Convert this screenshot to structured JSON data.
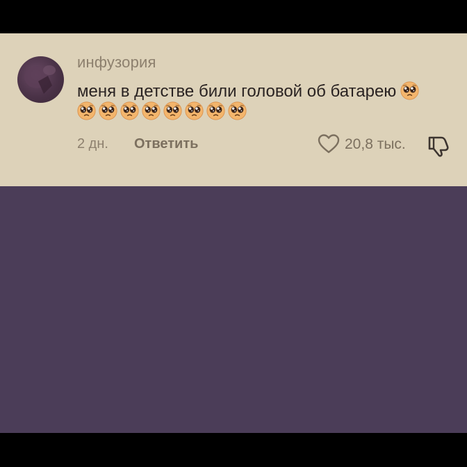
{
  "comment": {
    "username": "инфузория",
    "text": "меня в детстве били головой об батарею",
    "emoji_icon": "pleading-face-emoji",
    "emoji_count_inline": 1,
    "emoji_count_row": 8,
    "time_ago": "2 дн.",
    "reply_label": "Ответить",
    "like_count": "20,8 тыс."
  },
  "colors": {
    "card_background": "#ddd2b9",
    "video_area": "#4b3d58",
    "letterbox": "#000000",
    "username_text": "#8d806e",
    "comment_text": "#2a2322",
    "action_text": "#7c705f"
  },
  "icons": {
    "like": "heart-icon",
    "dislike": "thumbs-down-icon",
    "avatar": "avatar"
  }
}
